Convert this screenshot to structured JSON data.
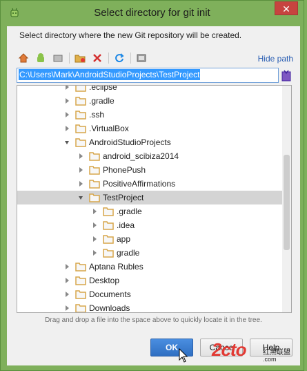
{
  "window": {
    "title": "Select directory for git init",
    "close_label": "✕"
  },
  "description": "Select directory where the new Git repository will be created.",
  "toolbar": {
    "icons": [
      "home-icon",
      "android-icon",
      "desktop-folder-icon",
      "new-folder-icon",
      "delete-icon",
      "refresh-icon",
      "show-hidden-icon"
    ],
    "hide_path_label": "Hide path"
  },
  "path": {
    "value": "C:\\Users\\Mark\\AndroidStudioProjects\\TestProject"
  },
  "tree": {
    "items": [
      {
        "label": ".eclipse",
        "depth": 1,
        "expanded": false,
        "selected": false
      },
      {
        "label": ".gradle",
        "depth": 1,
        "expanded": false,
        "selected": false
      },
      {
        "label": ".ssh",
        "depth": 1,
        "expanded": false,
        "selected": false
      },
      {
        "label": ".VirtualBox",
        "depth": 1,
        "expanded": false,
        "selected": false
      },
      {
        "label": "AndroidStudioProjects",
        "depth": 1,
        "expanded": true,
        "selected": false
      },
      {
        "label": "android_scibiza2014",
        "depth": 2,
        "expanded": false,
        "selected": false
      },
      {
        "label": "PhonePush",
        "depth": 2,
        "expanded": false,
        "selected": false
      },
      {
        "label": "PositiveAffirmations",
        "depth": 2,
        "expanded": false,
        "selected": false
      },
      {
        "label": "TestProject",
        "depth": 2,
        "expanded": true,
        "selected": true
      },
      {
        "label": ".gradle",
        "depth": 3,
        "expanded": false,
        "selected": false
      },
      {
        "label": ".idea",
        "depth": 3,
        "expanded": false,
        "selected": false
      },
      {
        "label": "app",
        "depth": 3,
        "expanded": false,
        "selected": false
      },
      {
        "label": "gradle",
        "depth": 3,
        "expanded": false,
        "selected": false
      },
      {
        "label": "Aptana Rubles",
        "depth": 1,
        "expanded": false,
        "selected": false
      },
      {
        "label": "Desktop",
        "depth": 1,
        "expanded": false,
        "selected": false
      },
      {
        "label": "Documents",
        "depth": 1,
        "expanded": false,
        "selected": false
      },
      {
        "label": "Downloads",
        "depth": 1,
        "expanded": false,
        "selected": false
      }
    ]
  },
  "hint": "Drag and drop a file into the space above to quickly locate it in the tree.",
  "buttons": {
    "ok": "OK",
    "cancel": "Cance",
    "help": "Help"
  },
  "watermark": {
    "big": "2cto",
    "small": "红黑联盟",
    "url": ".com"
  },
  "colors": {
    "accent": "#3399ff",
    "titlebar": "#7fb05b",
    "close": "#c7443f",
    "link": "#2b5fb3",
    "folder": "#d7a64a"
  }
}
